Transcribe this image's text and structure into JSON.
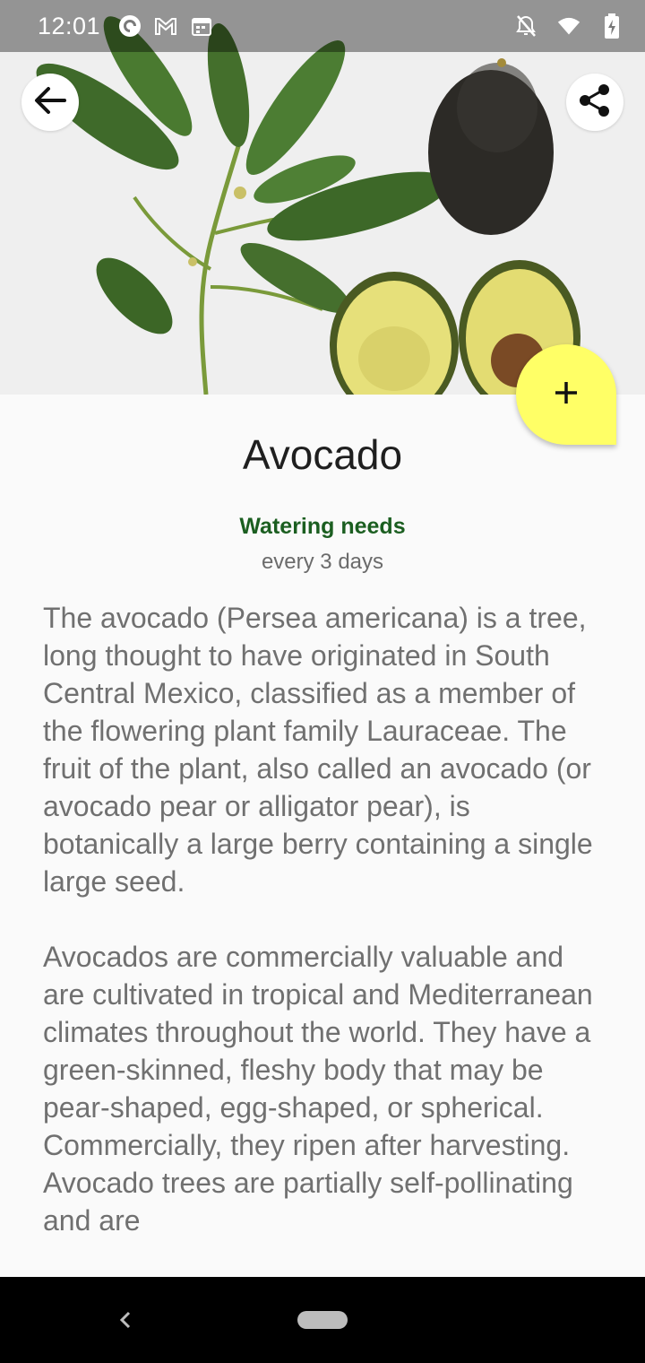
{
  "status_bar": {
    "time": "12:01",
    "left_icons": [
      "pocket-casts-icon",
      "gmail-icon",
      "calendar-icon"
    ],
    "right_icons": [
      "notifications-off-icon",
      "wifi-icon",
      "battery-charging-icon"
    ]
  },
  "toolbar": {
    "back_icon": "arrow-back-icon",
    "share_icon": "share-icon"
  },
  "fab": {
    "icon": "plus-icon",
    "color": "#ffff66"
  },
  "plant": {
    "name": "Avocado",
    "watering_title": "Watering needs",
    "watering_value": "every 3 days",
    "description": [
      "The avocado (Persea americana) is a tree, long thought to have originated in South Central Mexico, classified as a member of the flowering plant family Lauraceae. The fruit of the plant, also called an avocado (or avocado pear or alligator pear), is botanically a large berry containing a single large seed.",
      "Avocados are commercially valuable and are cultivated in tropical and Mediterranean climates throughout the world. They have a green-skinned, fleshy body that may be pear-shaped, egg-shaped, or spherical. Commercially, they ripen after harvesting. Avocado trees are partially self-pollinating and are"
    ]
  },
  "colors": {
    "accent_green": "#1b5e20",
    "fab_yellow": "#ffff66",
    "body_text": "#707070"
  }
}
